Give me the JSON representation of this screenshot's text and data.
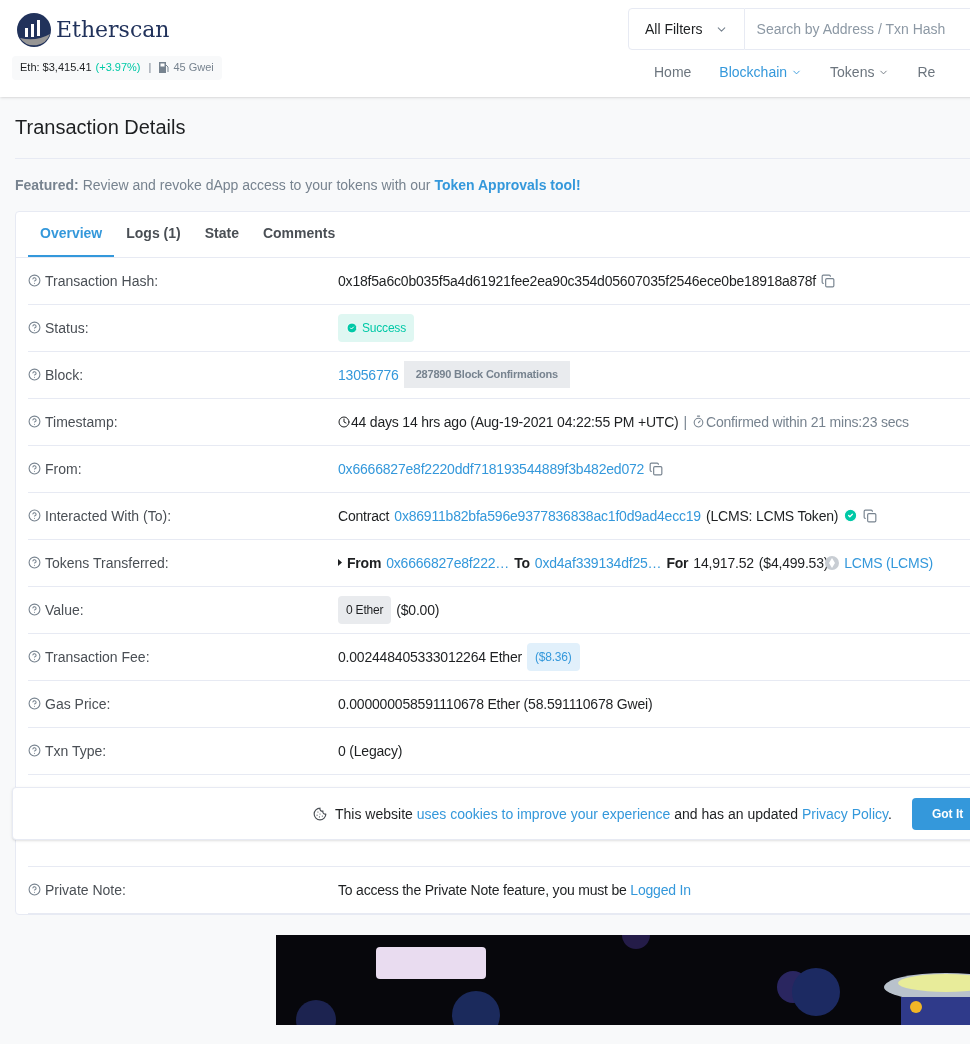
{
  "header": {
    "brand": "Etherscan",
    "price_label": "Eth: $3,415.41",
    "price_change": "(+3.97%)",
    "separator": "|",
    "gas": "45 Gwei",
    "filter": "All Filters",
    "search": {
      "placeholder": "Search by Address / Txn Hash"
    },
    "nav": [
      {
        "label": "Home",
        "selected": false,
        "dropdown": false
      },
      {
        "label": "Blockchain",
        "selected": true,
        "dropdown": true
      },
      {
        "label": "Tokens",
        "selected": false,
        "dropdown": true
      },
      {
        "label": "Re",
        "selected": false,
        "dropdown": false
      }
    ]
  },
  "page_title": "Transaction Details",
  "featured": {
    "label": "Featured:",
    "text": "Review and revoke dApp access to your tokens with our",
    "link": "Token Approvals tool!"
  },
  "tabs": [
    {
      "label": "Overview",
      "selected": true
    },
    {
      "label": "Logs (1)",
      "selected": false
    },
    {
      "label": "State",
      "selected": false
    },
    {
      "label": "Comments",
      "selected": false
    }
  ],
  "rows": [
    {
      "label": "Transaction Hash:",
      "segments": [
        {
          "kind": "text",
          "text": "0x18f5a6c0b035f5a4d61921fee2ea90c354d05607035f2546ece0be18918a878f"
        },
        {
          "kind": "copy"
        }
      ]
    },
    {
      "label": "Status:",
      "segments": [
        {
          "kind": "status",
          "text": "Success"
        }
      ]
    },
    {
      "label": "Block:",
      "segments": [
        {
          "kind": "link",
          "text": "13056776"
        },
        {
          "kind": "tag",
          "text": "287890 Block Confirmations"
        }
      ]
    },
    {
      "label": "Timestamp:",
      "segments": [
        {
          "kind": "clock"
        },
        {
          "kind": "text",
          "text": "44 days 14 hrs ago (Aug-19-2021 04:22:55 PM +UTC)"
        },
        {
          "kind": "muted",
          "text": "|"
        },
        {
          "kind": "timer"
        },
        {
          "kind": "muted",
          "text": "Confirmed within 21 mins:23 secs"
        }
      ]
    },
    {
      "label": "From:",
      "segments": [
        {
          "kind": "link",
          "text": "0x6666827e8f2220ddf718193544889f3b482ed072"
        },
        {
          "kind": "copy"
        }
      ]
    },
    {
      "label": "Interacted With (To):",
      "segments": [
        {
          "kind": "text",
          "text": "Contract"
        },
        {
          "kind": "link",
          "text": "0x86911b82bfa596e9377836838ac1f0d9ad4ecc19"
        },
        {
          "kind": "text",
          "text": "(LCMS: LCMS Token)"
        },
        {
          "kind": "verified"
        },
        {
          "kind": "copy"
        }
      ]
    },
    {
      "label": "Tokens Transferred:",
      "segments": [
        {
          "kind": "caret"
        },
        {
          "kind": "bold",
          "text": "From"
        },
        {
          "kind": "link",
          "text": "0x6666827e8f222…"
        },
        {
          "kind": "bold",
          "text": "To"
        },
        {
          "kind": "link",
          "text": "0xd4af339134df25…"
        },
        {
          "kind": "bold",
          "text": "For"
        },
        {
          "kind": "text",
          "text": "14,917.52"
        },
        {
          "kind": "text",
          "text": "($4,499.53)"
        },
        {
          "kind": "token"
        },
        {
          "kind": "link",
          "text": "LCMS (LCMS)"
        }
      ]
    },
    {
      "label": "Value:",
      "segments": [
        {
          "kind": "chip",
          "text": "0 Ether"
        },
        {
          "kind": "text",
          "text": "($0.00)"
        }
      ]
    },
    {
      "label": "Transaction Fee:",
      "segments": [
        {
          "kind": "text",
          "text": "0.002448405333012264 Ether"
        },
        {
          "kind": "price",
          "text": "($8.36)"
        }
      ]
    },
    {
      "label": "Gas Price:",
      "segments": [
        {
          "kind": "text",
          "text": "0.000000058591110678 Ether (58.591110678 Gwei)"
        }
      ]
    },
    {
      "label": "Txn Type:",
      "segments": [
        {
          "kind": "text",
          "text": "0 (Legacy)"
        }
      ]
    }
  ],
  "private_note": {
    "label": "Private Note:",
    "text": "To access the Private Note feature, you must be",
    "link": "Logged In"
  },
  "cookie_banner": {
    "text_before": "This website",
    "link": "uses cookies to improve your experience",
    "text_middle": "and has an updated",
    "policy_link": "Privacy Policy",
    "text_after": ".",
    "button": "Got It"
  }
}
